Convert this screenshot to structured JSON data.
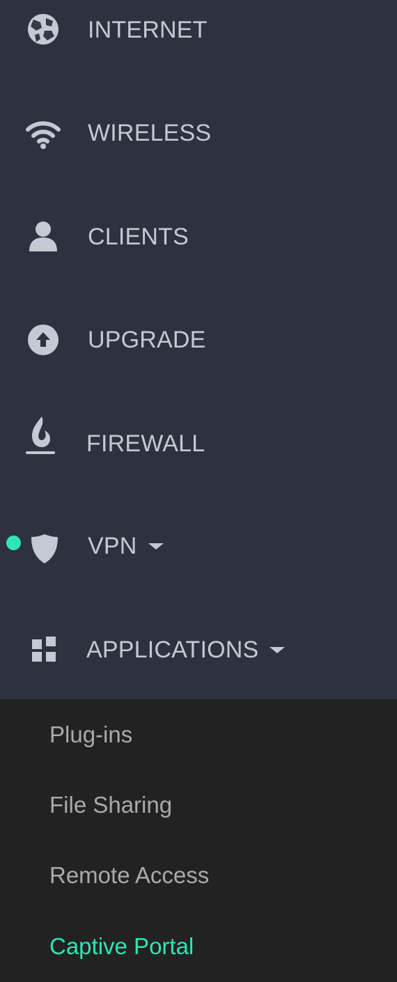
{
  "nav": {
    "items": [
      {
        "label": "INTERNET",
        "icon": "globe-icon"
      },
      {
        "label": "WIRELESS",
        "icon": "wifi-icon"
      },
      {
        "label": "CLIENTS",
        "icon": "user-icon"
      },
      {
        "label": "UPGRADE",
        "icon": "upload-arrow-icon"
      },
      {
        "label": "FIREWALL",
        "icon": "flame-icon"
      },
      {
        "label": "VPN",
        "icon": "shield-icon",
        "status": "active",
        "expandable": true
      },
      {
        "label": "APPLICATIONS",
        "icon": "grid-icon",
        "expandable": true
      }
    ]
  },
  "submenu": {
    "items": [
      {
        "label": "Plug-ins"
      },
      {
        "label": "File Sharing"
      },
      {
        "label": "Remote Access"
      },
      {
        "label": "Captive Portal",
        "active": true
      }
    ]
  },
  "colors": {
    "sidebar_bg": "#2e3240",
    "submenu_bg": "#222222",
    "text": "#c5c9d3",
    "submenu_text": "#a9abab",
    "accent": "#2ee6b3",
    "icon": "#c5c9d3"
  }
}
